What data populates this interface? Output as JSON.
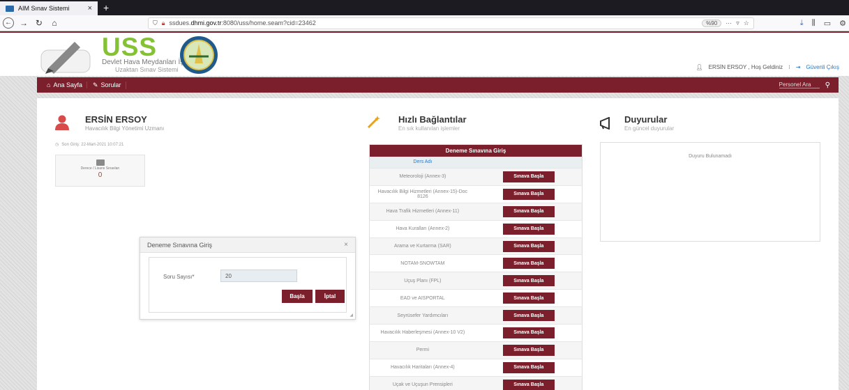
{
  "browser": {
    "tab_title": "AIM Sınav Sistemi",
    "tab_close": "×",
    "new_tab": "+",
    "url_prefix": "ssdues.",
    "url_domain": "dhmi.gov.tr",
    "url_suffix": ":8080/uss/home.seam?cid=23462",
    "zoom": "%90",
    "more": "···"
  },
  "header": {
    "logo_text": "USS",
    "org_line1": "Devlet Hava Meydanları İşletmesi",
    "org_line2": "Uzaktan Sınav Sistemi",
    "user_greeting": "ERSİN ERSOY , Hoş Geldiniz",
    "separator": "⁝",
    "logout": "Güvenli Çıkış"
  },
  "menu": {
    "home": "Ana Sayfa",
    "questions": "Sorular",
    "search_placeholder": "Personel Ara"
  },
  "profile": {
    "name": "ERSİN ERSOY",
    "title": "Havacılık Bilgi Yönetimi Uzmanı",
    "last_login": "Son Giriş: 22-Mart-2021 10:07:21",
    "stat_label": "Derece / Lisans Sınavları",
    "stat_value": "0"
  },
  "modal": {
    "title": "Deneme Sınavına Giriş",
    "close": "×",
    "question_count_label": "Soru Sayısı*",
    "question_count_value": "20",
    "start_button": "Başla",
    "cancel_button": "İptal"
  },
  "quick_links": {
    "title": "Hızlı Bağlantılar",
    "subtitle": "En sık kullanılan işlemler",
    "table_header": "Deneme Sınavına Giriş",
    "column_header": "Ders Adı",
    "button_label": "Sınava Başla",
    "courses": [
      "Meteoroloji (Annex-3)",
      "Havacılık Bilgi Hizmetleri (Annex-15)-Doc 8126",
      "Hava Trafik Hizmetleri (Annex-11)",
      "Hava Kuralları (Annex-2)",
      "Arama ve Kurtarma (SAR)",
      "NOTAM-SNOWTAM",
      "Uçuş Planı (FPL)",
      "EAD ve AISPORTAL",
      "Seyrüsefer Yardımcıları",
      "Havacılık Haberleşmesi (Annex-10 V2)",
      "Permi",
      "Havacılık Haritaları (Annex-4)",
      "Uçak ve Uçuşun Prensipleri"
    ]
  },
  "announcements": {
    "title": "Duyurular",
    "subtitle": "En güncel duyurular",
    "empty": "Duyuru Bulunamadı"
  },
  "colors": {
    "brand": "#7a1f2b",
    "logo_green": "#84c234",
    "link": "#2a7ac4"
  }
}
